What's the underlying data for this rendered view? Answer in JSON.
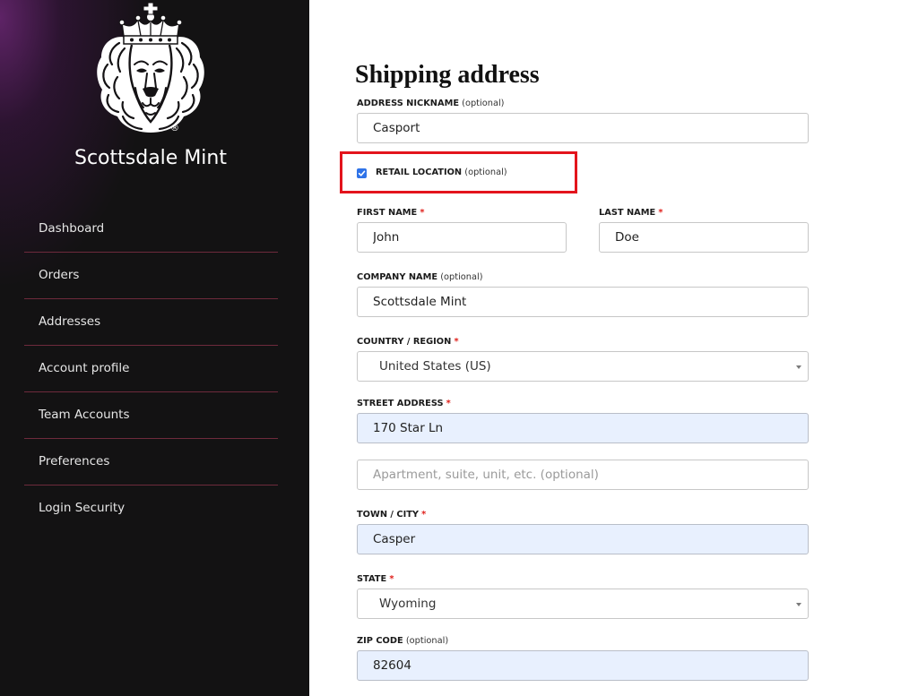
{
  "sidebar": {
    "brand_name": "Scottsdale Mint",
    "logo_registered_mark": "®",
    "nav_items": [
      {
        "label": "Dashboard"
      },
      {
        "label": "Orders"
      },
      {
        "label": "Addresses"
      },
      {
        "label": "Account profile"
      },
      {
        "label": "Team Accounts"
      },
      {
        "label": "Preferences"
      },
      {
        "label": "Login Security"
      }
    ]
  },
  "form": {
    "title": "Shipping address",
    "address_nickname": {
      "label": "ADDRESS NICKNAME",
      "note": "(optional)",
      "value": "Casport"
    },
    "retail_location": {
      "label": "RETAIL LOCATION",
      "note": "(optional)",
      "checked": true
    },
    "first_name": {
      "label": "FIRST NAME",
      "required_mark": "*",
      "value": "John"
    },
    "last_name": {
      "label": "LAST NAME",
      "required_mark": "*",
      "value": "Doe"
    },
    "company_name": {
      "label": "COMPANY NAME",
      "note": "(optional)",
      "value": "Scottsdale Mint"
    },
    "country_region": {
      "label": "COUNTRY / REGION",
      "required_mark": "*",
      "selected": "United States (US)"
    },
    "street_address": {
      "label": "STREET ADDRESS",
      "required_mark": "*",
      "value": "170 Star Ln",
      "autofilled": true
    },
    "street_address_2": {
      "placeholder": "Apartment, suite, unit, etc. (optional)"
    },
    "town_city": {
      "label": "TOWN / CITY",
      "required_mark": "*",
      "value": "Casper",
      "autofilled": true
    },
    "state": {
      "label": "STATE",
      "required_mark": "*",
      "selected": "Wyoming"
    },
    "zip_code": {
      "label": "ZIP CODE",
      "note": "(optional)",
      "value": "82604",
      "autofilled": true
    }
  },
  "icons": {
    "logo": "crowned-lion-icon",
    "select_arrow": "chevron-down-icon",
    "checkbox_check": "checkmark-icon"
  },
  "colors": {
    "sidebar_bg": "#131213",
    "sidebar_glow": "#5e2366",
    "nav_divider": "#6e2a3c",
    "required": "#e0201b",
    "autofill_bg": "#e8f0fe",
    "checkbox": "#2f73e8",
    "highlight_border": "#e3141c",
    "input_border": "#c7c7c7"
  }
}
